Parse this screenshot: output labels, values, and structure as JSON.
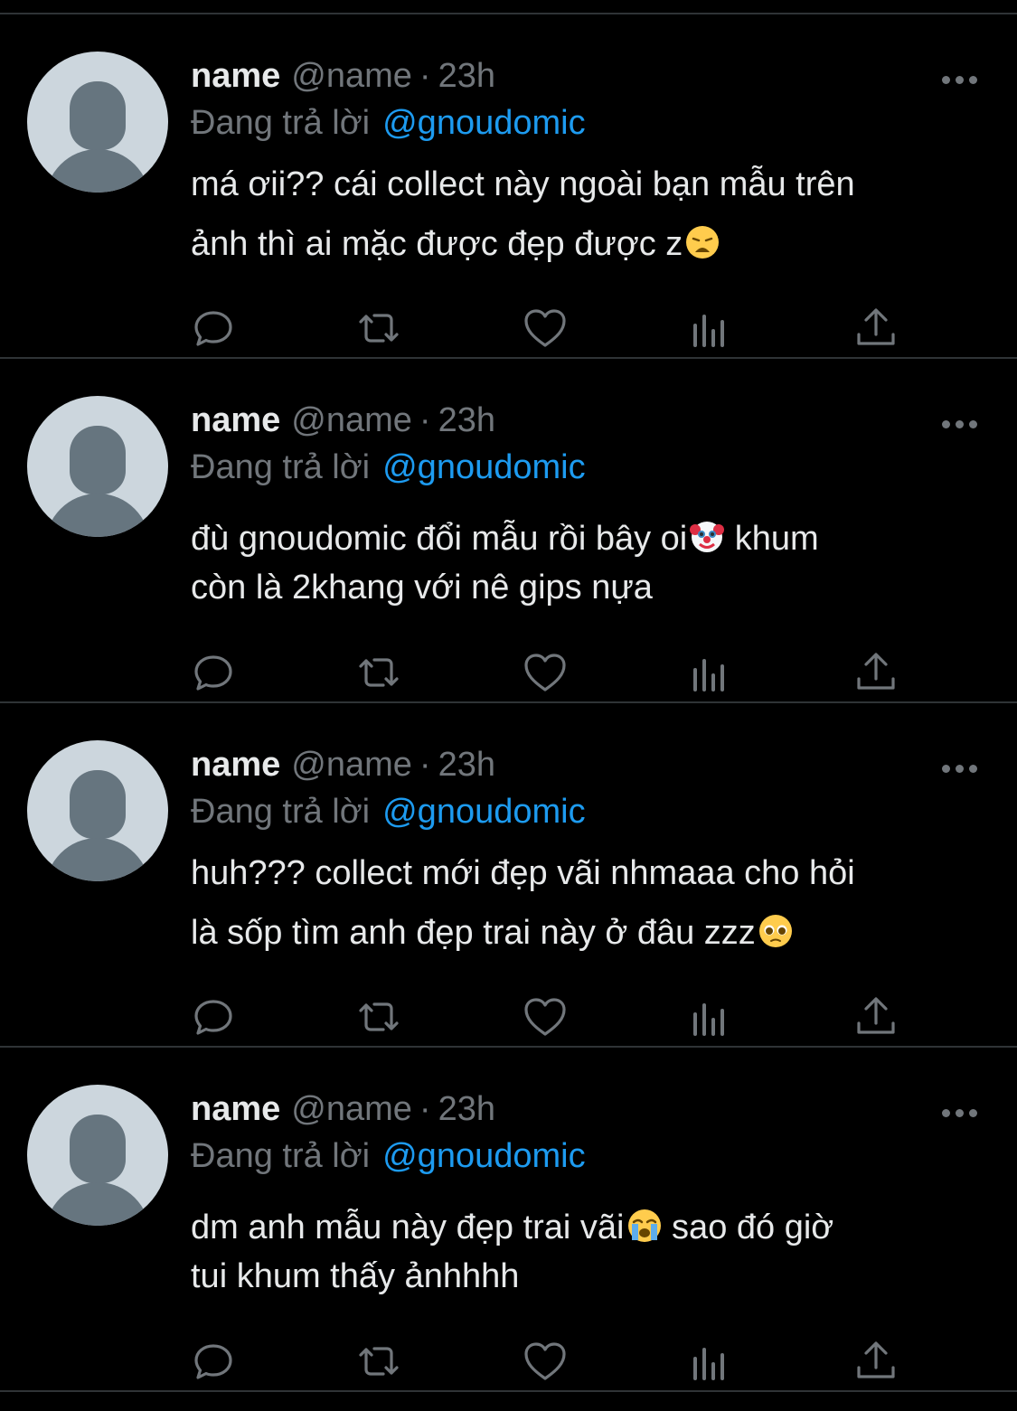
{
  "colors": {
    "background": "#000000",
    "divider": "#2f3336",
    "primary_text": "#e7e9ea",
    "secondary_text": "#71767b",
    "link": "#1d9bf0",
    "avatar_bg": "#ccd6dd",
    "avatar_fg": "#66757f"
  },
  "tweets": [
    {
      "name": "name",
      "handle": "@name",
      "separator": "·",
      "time": "23h",
      "replying_label": "Đang trả lời",
      "mention": "@gnoudomic",
      "line1": "má ơii?? cái collect này ngoài bạn mẫu trên",
      "line2": "ảnh thì ai mặc được đẹp được z",
      "emoji": "weary-face"
    },
    {
      "name": "name",
      "handle": "@name",
      "separator": "·",
      "time": "23h",
      "replying_label": "Đang trả lời",
      "mention": "@gnoudomic",
      "line1a": "đù gnoudomic đổi mẫu rồi bây oi",
      "line1b": " khum",
      "line2": "còn là 2khang với nê gips nựa",
      "emoji": "clown-face"
    },
    {
      "name": "name",
      "handle": "@name",
      "separator": "·",
      "time": "23h",
      "replying_label": "Đang trả lời",
      "mention": "@gnoudomic",
      "line1": "huh??? collect mới đẹp vãi nhmaaa cho hỏi",
      "line2": "là sốp tìm anh đẹp trai này ở đâu zzz",
      "emoji": "pleading-face"
    },
    {
      "name": "name",
      "handle": "@name",
      "separator": "·",
      "time": "23h",
      "replying_label": "Đang trả lời",
      "mention": "@gnoudomic",
      "line1a": "dm anh mẫu này đẹp trai vãi",
      "line1b": " sao đó giờ",
      "line2": "tui khum thấy ảnhhhh",
      "emoji": "loudly-crying-face"
    }
  ],
  "actions": [
    "reply-icon",
    "retweet-icon",
    "like-icon",
    "analytics-icon",
    "share-icon"
  ]
}
